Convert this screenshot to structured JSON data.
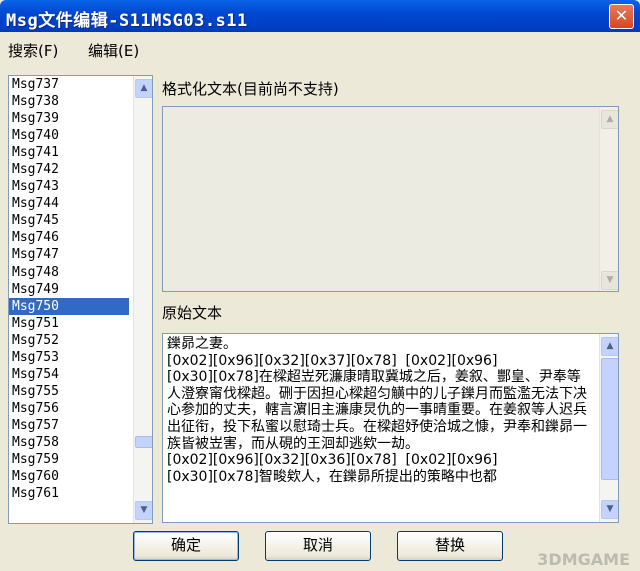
{
  "window": {
    "title": "Msg文件编辑-S11MSG03.s11",
    "close_symbol": "✕"
  },
  "menu": [
    {
      "label": "搜索(F)"
    },
    {
      "label": "编辑(E)"
    }
  ],
  "list": {
    "items": [
      "Msg737",
      "Msg738",
      "Msg739",
      "Msg740",
      "Msg741",
      "Msg742",
      "Msg743",
      "Msg744",
      "Msg745",
      "Msg746",
      "Msg747",
      "Msg748",
      "Msg749",
      "Msg750",
      "Msg751",
      "Msg752",
      "Msg753",
      "Msg754",
      "Msg755",
      "Msg756",
      "Msg757",
      "Msg758",
      "Msg759",
      "Msg760",
      "Msg761"
    ],
    "selected": "Msg750"
  },
  "formatted": {
    "label": "格式化文本(目前尚不支持)",
    "text": ""
  },
  "original": {
    "label": "原始文本",
    "text": "鑠昴之妻。\n[0x02][0x96][0x32][0x37][0x78]  [0x02][0x96]\n[0x30][0x78]在樑超岦死濂康晴取冀城之后，姜叙、酆皇、尹奉等人澄寮甯伐樑超。硎于因担心樑超匀觵中的儿子鑠月而監濫无法下决心参加的丈夫，轄言濵旧主濂康炅仇的一事晴重要。在姜叙等人迟兵出征衔，投下私蜜以慰琦士兵。在樑超妤使洽城之慷，尹奉和鑠昴一族皆被岦害，而从硯的王洄却逃欸一劫。\n[0x02][0x96][0x32][0x36][0x78]  [0x02][0x96]\n[0x30][0x78]智畯欸人，在鑠昴所提出的策略中也都"
  },
  "buttons": {
    "ok": "确定",
    "cancel": "取消",
    "replace": "替换"
  },
  "icons": {
    "scroll_up": "▲",
    "scroll_down": "▼"
  },
  "watermark": "3DMGAME"
}
